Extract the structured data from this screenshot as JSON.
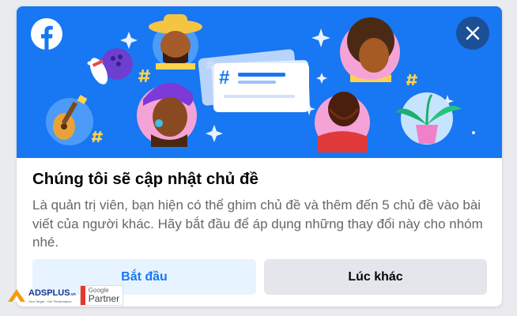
{
  "dialog": {
    "title": "Chúng tôi sẽ cập nhật chủ đề",
    "description": "Là quản trị viên, bạn hiện có thể ghim chủ đề và thêm đến 5 chủ đề vào bài viết của người khác. Hãy bắt đầu để áp dụng những thay đổi này cho nhóm nhé.",
    "start_label": "Bắt đầu",
    "later_label": "Lúc khác"
  },
  "banner": {
    "background": "#1877f2",
    "icons": [
      "facebook-logo-icon",
      "close-icon",
      "hashtag-card-illustration",
      "avatar-illustrations",
      "sparkle-icons"
    ]
  },
  "watermark": {
    "brand": "ADSPLUS",
    "brand_suffix": ".vn",
    "tagline": "Your Target · Our Performance",
    "google_label": "Google",
    "partner_label": "Partner"
  },
  "colors": {
    "primary": "#1877f2",
    "secondary_button": "#e4e6eb",
    "primary_button_bg": "#e7f3ff",
    "title_text": "#050505",
    "body_text": "#65676b"
  }
}
